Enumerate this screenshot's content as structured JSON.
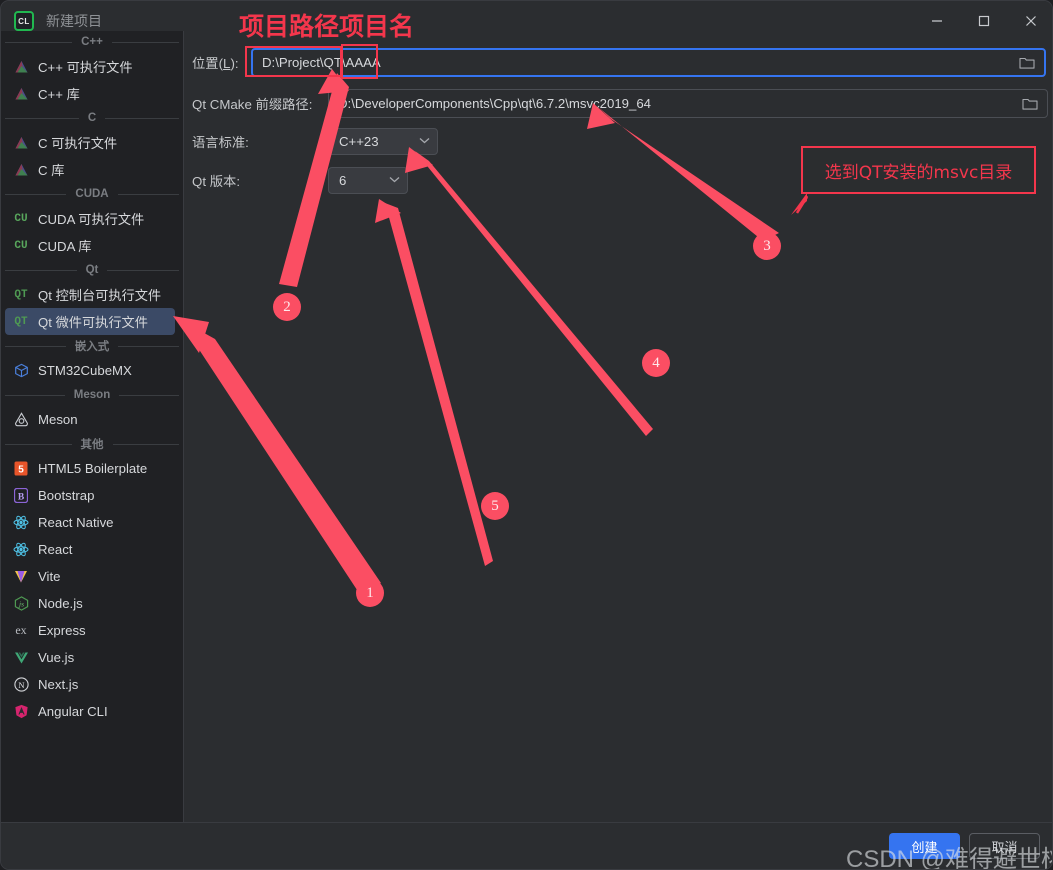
{
  "window": {
    "title": "新建项目",
    "logo_text": "CL",
    "controls": [
      {
        "name": "minimize",
        "glyph": "—"
      },
      {
        "name": "maximize",
        "glyph": "▢"
      },
      {
        "name": "close",
        "glyph": "✕"
      }
    ]
  },
  "sidebar": {
    "groups": [
      {
        "label": "C++",
        "items": [
          {
            "label": "C++ 可执行文件",
            "icon": "cmake-triangle-icon",
            "selected": false
          },
          {
            "label": "C++ 库",
            "icon": "cmake-triangle-icon",
            "selected": false
          }
        ]
      },
      {
        "label": "C",
        "items": [
          {
            "label": "C 可执行文件",
            "icon": "cmake-triangle-icon",
            "selected": false
          },
          {
            "label": "C 库",
            "icon": "cmake-triangle-icon",
            "selected": false
          }
        ]
      },
      {
        "label": "CUDA",
        "items": [
          {
            "label": "CUDA 可执行文件",
            "icon": "cuda-icon",
            "selected": false
          },
          {
            "label": "CUDA 库",
            "icon": "cuda-icon",
            "selected": false
          }
        ]
      },
      {
        "label": "Qt",
        "items": [
          {
            "label": "Qt 控制台可执行文件",
            "icon": "qt-icon",
            "selected": false
          },
          {
            "label": "Qt 微件可执行文件",
            "icon": "qt-icon",
            "selected": true
          }
        ]
      },
      {
        "label": "嵌入式",
        "items": [
          {
            "label": "STM32CubeMX",
            "icon": "cube-icon",
            "selected": false
          }
        ]
      },
      {
        "label": "Meson",
        "items": [
          {
            "label": "Meson",
            "icon": "meson-icon",
            "selected": false
          }
        ]
      },
      {
        "label": "其他",
        "items": [
          {
            "label": "HTML5 Boilerplate",
            "icon": "html5-icon",
            "selected": false
          },
          {
            "label": "Bootstrap",
            "icon": "bootstrap-icon",
            "selected": false
          },
          {
            "label": "React Native",
            "icon": "react-icon",
            "selected": false
          },
          {
            "label": "React",
            "icon": "react-icon",
            "selected": false
          },
          {
            "label": "Vite",
            "icon": "vite-icon",
            "selected": false
          },
          {
            "label": "Node.js",
            "icon": "nodejs-icon",
            "selected": false
          },
          {
            "label": "Express",
            "icon": "express-icon",
            "selected": false
          },
          {
            "label": "Vue.js",
            "icon": "vuejs-icon",
            "selected": false
          },
          {
            "label": "Next.js",
            "icon": "nextjs-icon",
            "selected": false
          },
          {
            "label": "Angular CLI",
            "icon": "angular-icon",
            "selected": false
          }
        ]
      }
    ]
  },
  "form": {
    "location_label": "位置(L):",
    "location_label_plain": "位置(",
    "location_label_mnemonic": "L",
    "location_label_tail": "):",
    "location_value": "D:\\Project\\QT\\AAAA",
    "location_path_part": "D:\\Project\\QT\\",
    "location_name_part": "AAAA",
    "qt_cmake_label": "Qt CMake 前缀路径:",
    "qt_cmake_value": "D:\\DeveloperComponents\\Cpp\\qt\\6.7.2\\msvc2019_64",
    "lang_std_label": "语言标准:",
    "lang_std_value": "C++23",
    "qt_version_label": "Qt 版本:",
    "qt_version_value": "6",
    "browse_icon": "folder-icon",
    "chevron_icon": "chevron-down-icon"
  },
  "footer": {
    "create_label": "创建",
    "cancel_label": "取消"
  },
  "annotations": {
    "heading_path": "项目路径",
    "heading_name": "项目名",
    "callout_text": "选到QT安装的msvc目录",
    "markers": [
      "1",
      "2",
      "3",
      "4",
      "5"
    ]
  },
  "watermark": {
    "text": "CSDN @难得避世桃源"
  },
  "colors": {
    "accent_red": "#f4364c",
    "marker_red": "#fb4e63",
    "primary_blue": "#3574f0",
    "selection_blue": "#3b4a66",
    "window_bg": "#2b2d30",
    "sidebar_bg": "#202124"
  }
}
